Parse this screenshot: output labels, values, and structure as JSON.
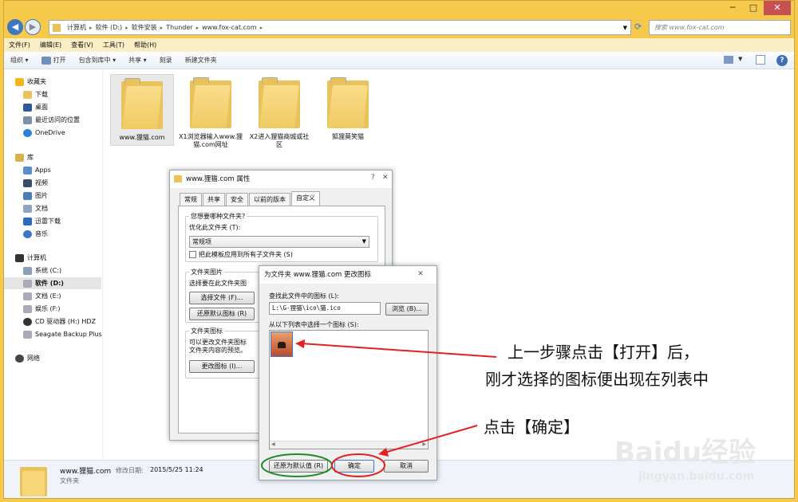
{
  "window": {
    "minimize": "─",
    "maximize": "□",
    "close": "✕"
  },
  "address": {
    "crumbs": [
      "计算机",
      "软件 (D:)",
      "软件安装",
      "Thunder",
      "www.fox-cat.com"
    ],
    "sep": "▸"
  },
  "search": {
    "placeholder": "搜索 www.fox-cat.com"
  },
  "menu": [
    "文件(F)",
    "编辑(E)",
    "查看(V)",
    "工具(T)",
    "帮助(H)"
  ],
  "toolbar": {
    "organize": "组织 ▾",
    "open": "打开",
    "include": "包含到库中 ▾",
    "share": "共享 ▾",
    "burn": "刻录",
    "new_folder": "新建文件夹"
  },
  "nav": {
    "favorites": "收藏夹",
    "downloads": "下载",
    "desktop": "桌面",
    "recent": "最近访问的位置",
    "onedrive": "OneDrive",
    "libraries": "库",
    "apps": "Apps",
    "videos": "视频",
    "pictures": "图片",
    "documents": "文档",
    "thunder_dl": "迅雷下载",
    "music": "音乐",
    "computer": "计算机",
    "drive_c": "系统 (C:)",
    "drive_d": "软件 (D:)",
    "drive_e": "文档 (E:)",
    "drive_f": "娱乐 (F:)",
    "drive_h": "CD 驱动器 (H:) HDZ",
    "seagate": "Seagate Backup Plus",
    "network": "网络"
  },
  "folders": [
    {
      "name": "www.狸猫.com"
    },
    {
      "name": "X1浏览器输入www.狸猫.com网址"
    },
    {
      "name": "X2进入狸猫商城或社区"
    },
    {
      "name": "狐狸莫笑猫"
    }
  ],
  "status": {
    "name": "www.狸猫.com",
    "modified_label": "修改日期:",
    "modified": "2015/5/25 11:24",
    "type": "文件夹"
  },
  "props": {
    "title": "www.狸猫.com 属性",
    "tabs": [
      "常规",
      "共享",
      "安全",
      "以前的版本",
      "自定义"
    ],
    "q1": "您想要哪种文件夹?",
    "optimize_label": "优化此文件夹 (T):",
    "optimize_value": "常规项",
    "apply_sub": "把此模板应用到所有子文件夹 (S)",
    "folder_pic": "文件夹图片",
    "select_pic_desc": "选择要在此文件夹图",
    "choose_file": "选择文件 (F)...",
    "restore_default": "还原默认图标 (R)",
    "folder_icon": "文件夹图标",
    "icon_desc1": "可以更改文件夹图标",
    "icon_desc2": "文件夹内容的预览。",
    "change_icon": "更改图标 (I)...",
    "help": "?",
    "close": "✕"
  },
  "change_icon": {
    "title": "为文件夹 www.狸猫.com 更改图标",
    "find_label": "查找此文件中的图标 (L):",
    "path": "L:\\G-狸猫\\ico\\猫.ico",
    "browse": "浏览 (B)...",
    "select_label": "从以下列表中选择一个图标 (S):",
    "restore": "还原为默认值 (R)",
    "ok": "确定",
    "cancel": "取消",
    "close": "✕"
  },
  "annotations": {
    "line1": "上一步骤点击【打开】后，",
    "line2": "刚才选择的图标便出现在列表中",
    "line3": "点击【确定】"
  },
  "watermark": {
    "logo": "Baidu经验",
    "url": "jingyan.baidu.com"
  },
  "colors": {
    "accent_red": "#e52020",
    "accent_green": "#1f8a2c",
    "frame": "#f6c94a"
  }
}
